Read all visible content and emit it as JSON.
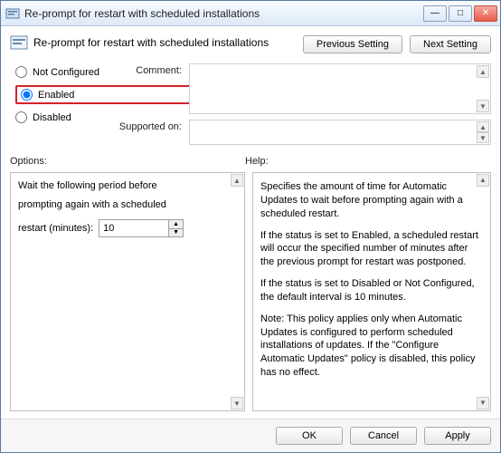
{
  "window": {
    "title": "Re-prompt for restart with scheduled installations"
  },
  "header": {
    "title": "Re-prompt for restart with scheduled installations",
    "prev_btn": "Previous Setting",
    "next_btn": "Next Setting"
  },
  "radios": {
    "not_configured": "Not Configured",
    "enabled": "Enabled",
    "disabled": "Disabled",
    "selected": "enabled"
  },
  "fields": {
    "comment_label": "Comment:",
    "comment_value": "",
    "supported_label": "Supported on:",
    "supported_value": ""
  },
  "sections": {
    "options_label": "Options:",
    "help_label": "Help:"
  },
  "options": {
    "line1": "Wait the following period before",
    "line2": "prompting again with a scheduled",
    "restart_label": "restart (minutes):",
    "restart_value": "10"
  },
  "help": {
    "p1": "Specifies the amount of time for Automatic Updates to wait before prompting again with a scheduled restart.",
    "p2": "If the status is set to Enabled, a scheduled restart will occur the specified number of minutes after the previous prompt for restart was postponed.",
    "p3": "If the status is set to Disabled or Not Configured, the default interval is 10 minutes.",
    "p4": "Note: This policy applies only when Automatic Updates is configured to perform scheduled installations of updates. If the \"Configure Automatic Updates\" policy is disabled, this policy has no effect."
  },
  "footer": {
    "ok": "OK",
    "cancel": "Cancel",
    "apply": "Apply"
  }
}
